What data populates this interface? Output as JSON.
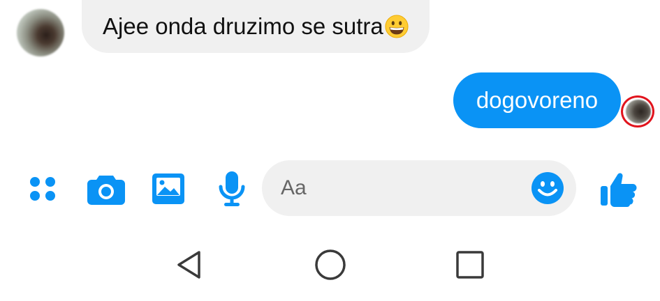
{
  "conversation": {
    "incoming": {
      "text": "Ajee onda druzimo se sutra",
      "emoji_icon": "grinning-face-emoji"
    },
    "outgoing": {
      "text": "dogovoreno"
    }
  },
  "composer": {
    "placeholder": "Aa",
    "icons": [
      "apps-grid-icon",
      "camera-icon",
      "gallery-icon",
      "microphone-icon",
      "emoji-smiley-icon",
      "thumbs-up-icon"
    ]
  },
  "nav": {
    "icons": [
      "back-icon",
      "home-icon",
      "recents-icon"
    ]
  },
  "colors": {
    "accent": "#0a93f5",
    "incoming_bubble": "#f0f0f0",
    "seen_highlight": "#e1141d",
    "nav_icon": "#3a3a3a"
  }
}
